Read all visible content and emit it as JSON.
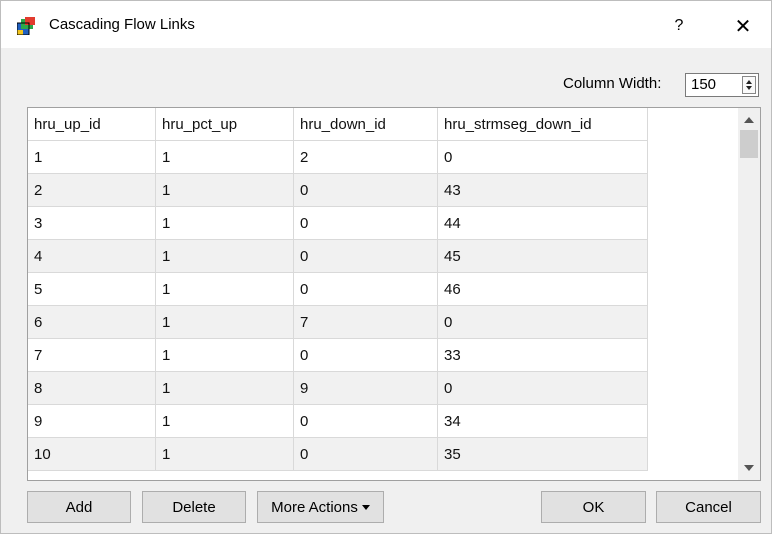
{
  "window": {
    "title": "Cascading Flow Links",
    "help_label": "?",
    "close_label": "✕"
  },
  "toolbar": {
    "column_width_label": "Column Width:",
    "column_width_value": "150"
  },
  "table": {
    "headers": [
      "hru_up_id",
      "hru_pct_up",
      "hru_down_id",
      "hru_strmseg_down_id"
    ],
    "rows": [
      [
        "1",
        "1",
        "2",
        "0"
      ],
      [
        "2",
        "1",
        "0",
        "43"
      ],
      [
        "3",
        "1",
        "0",
        "44"
      ],
      [
        "4",
        "1",
        "0",
        "45"
      ],
      [
        "5",
        "1",
        "0",
        "46"
      ],
      [
        "6",
        "1",
        "7",
        "0"
      ],
      [
        "7",
        "1",
        "0",
        "33"
      ],
      [
        "8",
        "1",
        "9",
        "0"
      ],
      [
        "9",
        "1",
        "0",
        "34"
      ],
      [
        "10",
        "1",
        "0",
        "35"
      ]
    ]
  },
  "buttons": {
    "add": "Add",
    "delete": "Delete",
    "more_actions": "More Actions",
    "ok": "OK",
    "cancel": "Cancel"
  }
}
